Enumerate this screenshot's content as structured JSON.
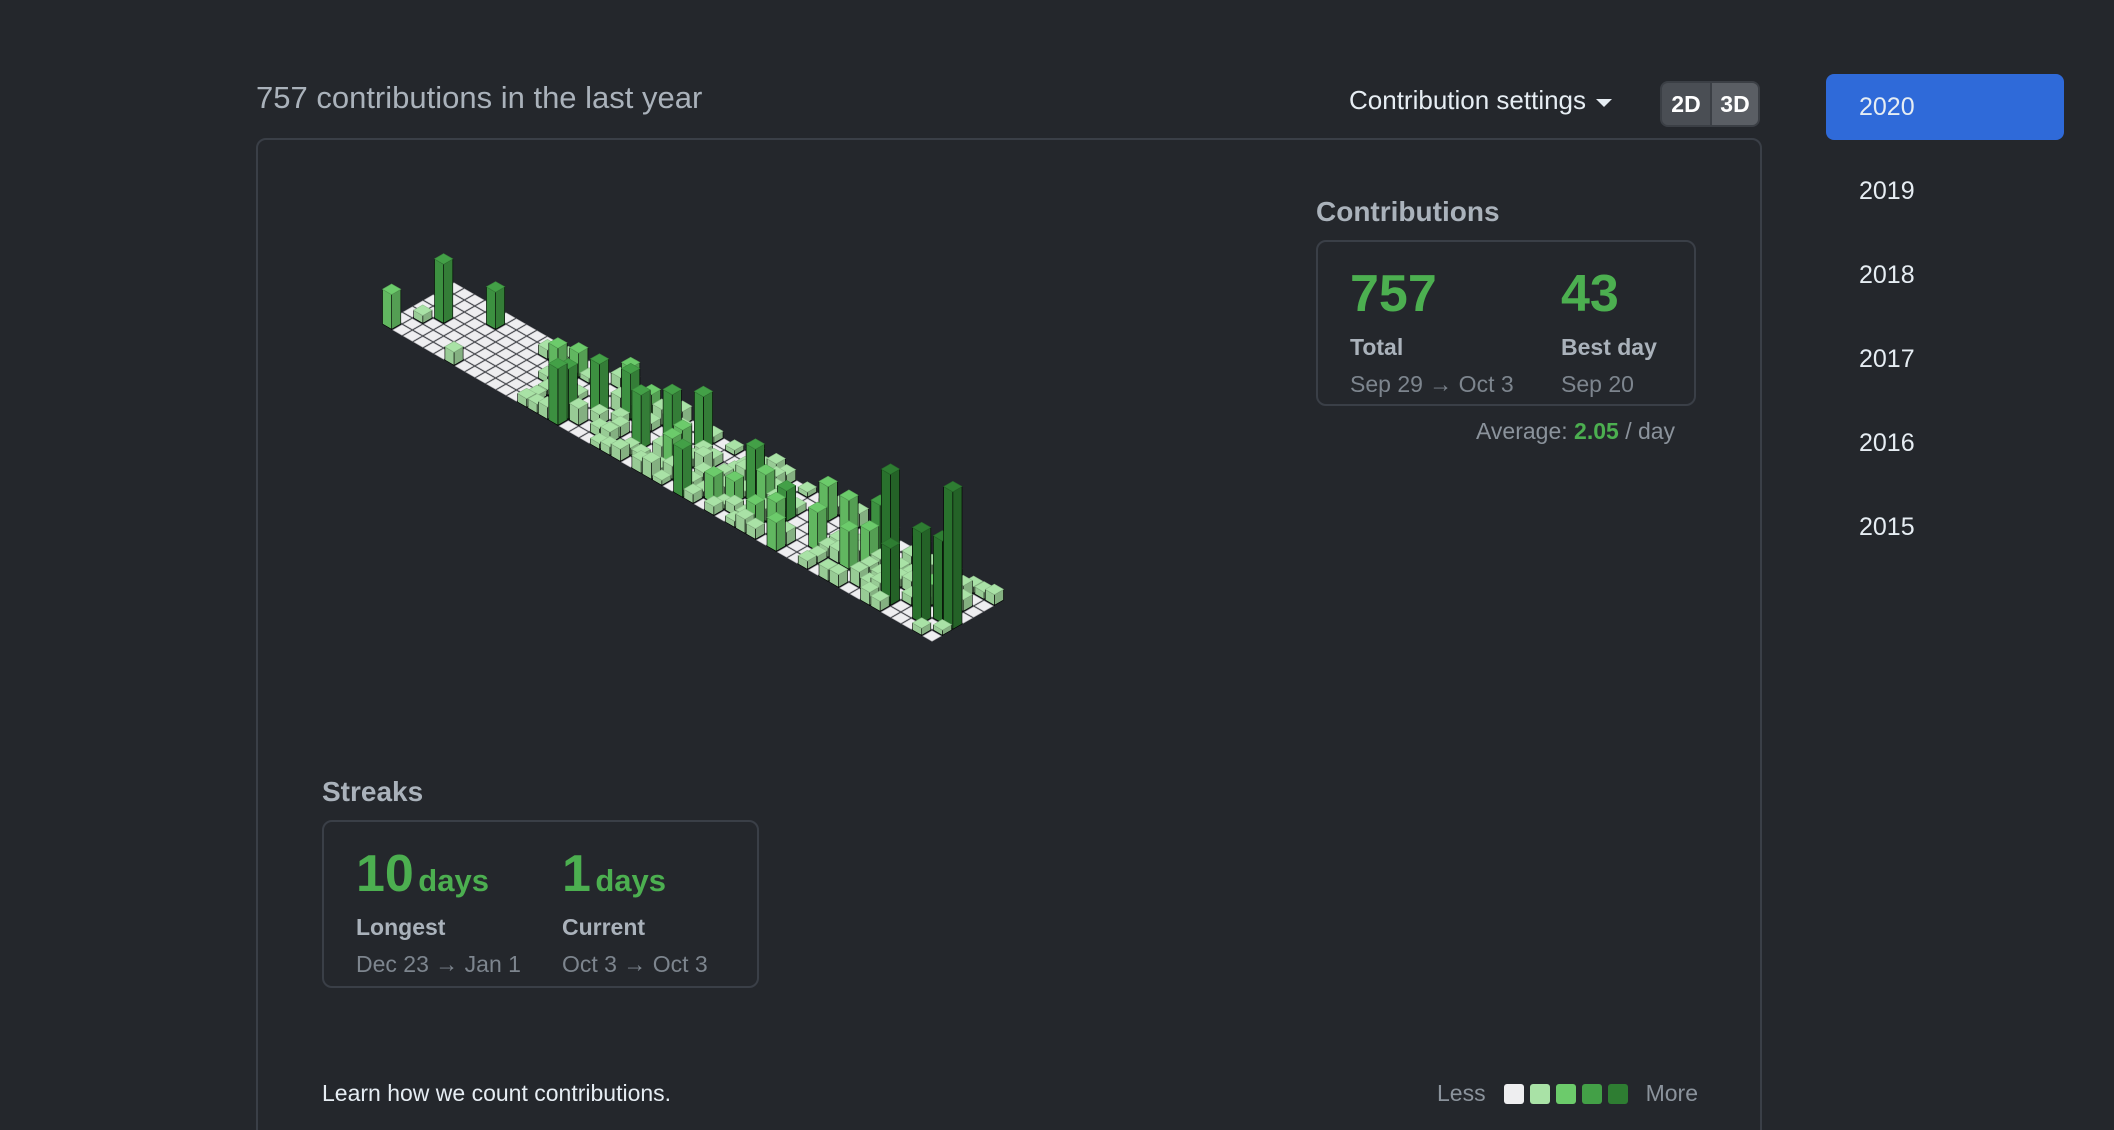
{
  "header": {
    "title": "757 contributions in the last year",
    "settings_label": "Contribution settings",
    "toggle_2d": "2D",
    "toggle_3d": "3D"
  },
  "contributions": {
    "heading": "Contributions",
    "total_value": "757",
    "total_label": "Total",
    "total_range": "Sep 29 → Oct 3",
    "best_value": "43",
    "best_label": "Best day",
    "best_date": "Sep 20",
    "average_prefix": "Average:",
    "average_value": "2.05",
    "average_suffix": "/ day"
  },
  "streaks": {
    "heading": "Streaks",
    "longest_value": "10",
    "longest_unit": "days",
    "longest_label": "Longest",
    "longest_range": "Dec 23 → Jan 1",
    "current_value": "1",
    "current_unit": "days",
    "current_label": "Current",
    "current_range": "Oct 3 → Oct 3"
  },
  "footer": {
    "learn_link": "Learn how we count contributions.",
    "legend_less": "Less",
    "legend_more": "More"
  },
  "colors": {
    "empty": "#eeeef0",
    "level1": "#a9e2a6",
    "level2": "#6ccb6b",
    "level3": "#43a047",
    "level4": "#2e7d32",
    "accent": "#4caf50",
    "active_year": "#2f6ad9"
  },
  "years": {
    "items": [
      "2020",
      "2019",
      "2018",
      "2017",
      "2016",
      "2015"
    ],
    "active": "2020"
  }
}
